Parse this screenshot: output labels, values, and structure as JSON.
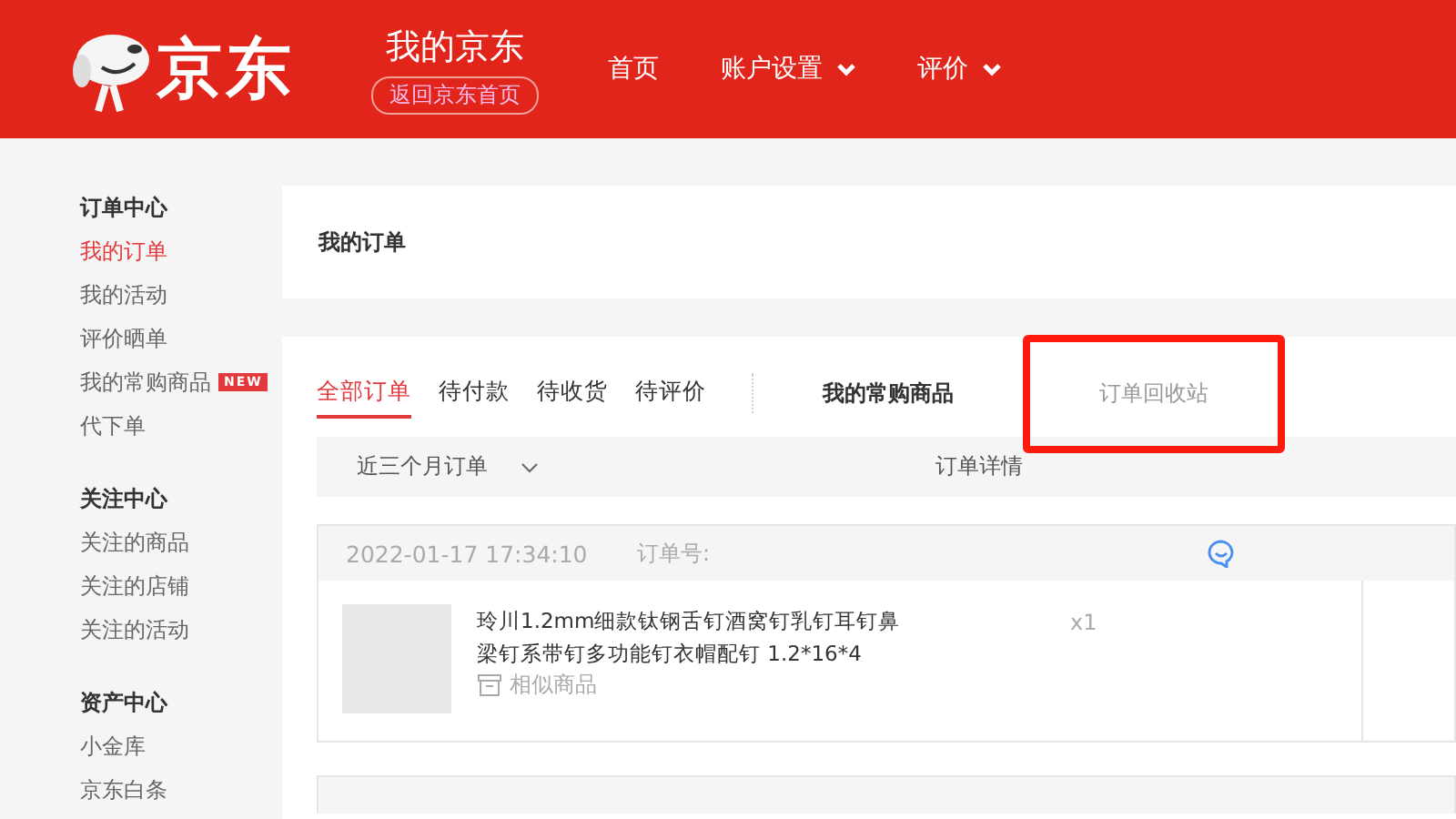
{
  "header": {
    "logo_text": "京东",
    "title": "我的京东",
    "back_link": "返回京东首页",
    "nav": [
      {
        "label": "首页",
        "dropdown": false
      },
      {
        "label": "账户设置",
        "dropdown": true
      },
      {
        "label": "评价",
        "dropdown": true
      }
    ]
  },
  "sidebar": {
    "sections": [
      {
        "title": "订单中心",
        "items": [
          {
            "label": "我的订单",
            "selected": true
          },
          {
            "label": "我的活动",
            "selected": false
          },
          {
            "label": "评价晒单",
            "selected": false
          },
          {
            "label": "我的常购商品",
            "selected": false,
            "badge": "NEW"
          },
          {
            "label": "代下单",
            "selected": false
          }
        ]
      },
      {
        "title": "关注中心",
        "items": [
          {
            "label": "关注的商品",
            "selected": false
          },
          {
            "label": "关注的店铺",
            "selected": false
          },
          {
            "label": "关注的活动",
            "selected": false
          }
        ]
      },
      {
        "title": "资产中心",
        "items": [
          {
            "label": "小金库",
            "selected": false
          },
          {
            "label": "京东白条",
            "selected": false
          }
        ]
      }
    ]
  },
  "page_title": "我的订单",
  "tabs": [
    {
      "label": "全部订单",
      "selected": true
    },
    {
      "label": "待付款",
      "selected": false
    },
    {
      "label": "待收货",
      "selected": false
    },
    {
      "label": "待评价",
      "selected": false
    }
  ],
  "frequent_link": "我的常购商品",
  "recycle_link": {
    "label": "订单回收站",
    "highlighted": true
  },
  "table_header": {
    "range": "近三个月订单",
    "details": "订单详情"
  },
  "orders": [
    {
      "time": "2022-01-17 17:34:10",
      "order_no_label": "订单号:",
      "product": "玲川1.2mm细款钛钢舌钉酒窝钉乳钉耳钉鼻梁钉系带钉多功能钉衣帽配钉 1.2*16*4",
      "similar": "相似商品",
      "qty": "x1"
    }
  ]
}
